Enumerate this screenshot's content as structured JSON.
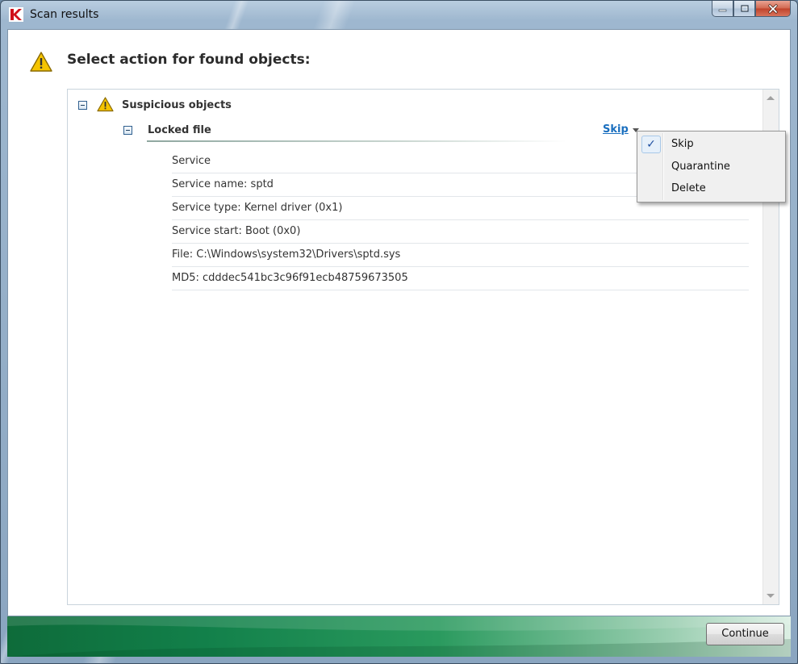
{
  "window": {
    "title": "Scan results",
    "logo_icon": "kaspersky-k-logo",
    "caption_icons": [
      "minimize-icon",
      "maximize-icon",
      "close-icon"
    ]
  },
  "header": {
    "icon": "warning-icon",
    "title": "Select action for found objects:"
  },
  "tree": {
    "group": {
      "icon": "warning-icon",
      "label": "Suspicious objects"
    },
    "item": {
      "label": "Locked file",
      "action_label": "Skip",
      "details": [
        "Service",
        "Service name: sptd",
        "Service type: Kernel driver (0x1)",
        "Service start: Boot (0x0)",
        "File: C:\\Windows\\system32\\Drivers\\sptd.sys",
        "MD5: cdddec541bc3c96f91ecb48759673505"
      ]
    }
  },
  "action_menu": {
    "items": [
      {
        "label": "Skip",
        "checked": true
      },
      {
        "label": "Quarantine",
        "checked": false
      },
      {
        "label": "Delete",
        "checked": false
      }
    ],
    "check_glyph": "✓"
  },
  "footer": {
    "continue_label": "Continue"
  },
  "colors": {
    "link": "#1a6fbf",
    "footer_green": "#12804a",
    "warning_yellow": "#f5c400"
  }
}
